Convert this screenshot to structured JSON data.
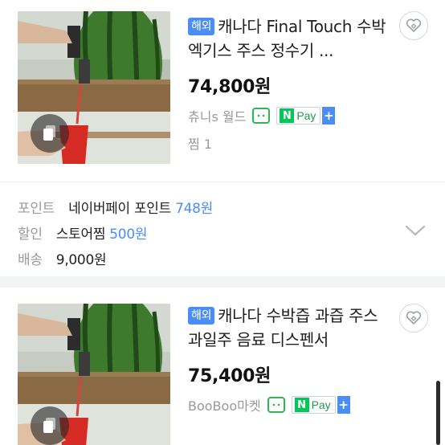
{
  "products": [
    {
      "badge": "해외",
      "title": "캐나다 Final Touch 수박 엑기스 주스 정수기 ...",
      "price": "74,800",
      "price_unit": "원",
      "seller": "츄니s 월드",
      "talk_icon": "talk-icon",
      "npay_n": "N",
      "npay_label": "Pay",
      "plus": "+",
      "wish_label": "찜",
      "wish_count": "1"
    },
    {
      "badge": "해외",
      "title": "캐나다 수박즙 과즙 주스 과일주 음료 디스펜서",
      "price": "75,400",
      "price_unit": "원",
      "seller": "BooBoo마켓",
      "talk_icon": "talk-icon",
      "npay_n": "N",
      "npay_label": "Pay",
      "plus": "+"
    }
  ],
  "benefits": {
    "point_label": "포인트",
    "point_value": "네이버페이 포인트",
    "point_amount": "748원",
    "discount_label": "할인",
    "discount_value": "스토어찜",
    "discount_amount": "500원",
    "shipping_label": "배송",
    "shipping_value": "9,000원"
  },
  "colors": {
    "accent": "#4a8ef5",
    "npay_green": "#03c75a",
    "talk_green": "#2fb552"
  }
}
